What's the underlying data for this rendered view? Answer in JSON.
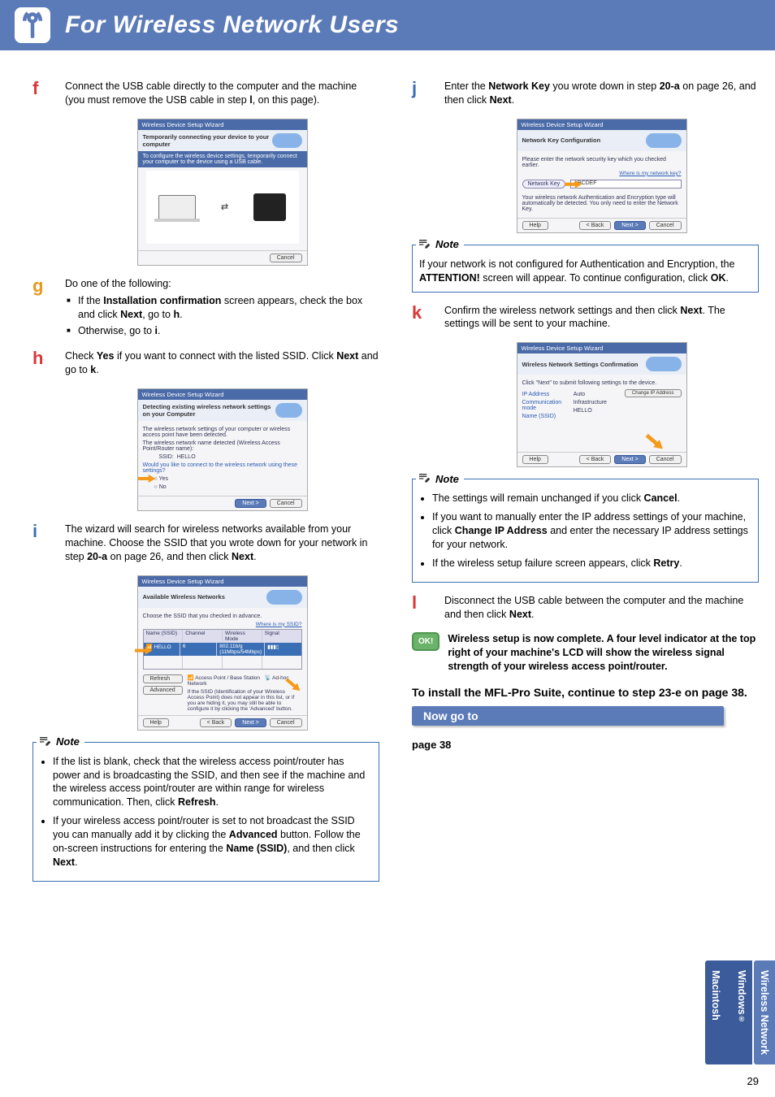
{
  "header": {
    "title": "For Wireless Network Users"
  },
  "left": {
    "f": {
      "letter": "f",
      "text": "Connect the USB cable directly to the computer and the machine (you must remove the USB cable in step ",
      "bold1": "l",
      "text2": ", on this page).",
      "shot_title": "Wireless Device Setup Wizard",
      "shot_sub": "Temporarily connecting your device to your computer",
      "shot_desc": "To configure the wireless device settings, temporarily connect your computer to the device using a USB cable.",
      "btn_cancel": "Cancel"
    },
    "g": {
      "letter": "g",
      "intro": "Do one of the following:",
      "bul1a": "If the ",
      "bul1b": "Installation confirmation",
      "bul1c": " screen appears, check the box and click ",
      "bul1d": "Next",
      "bul1e": ", go to ",
      "bul1f": "h",
      "bul1g": ".",
      "bul2a": "Otherwise, go to ",
      "bul2b": "i",
      "bul2c": "."
    },
    "h": {
      "letter": "h",
      "p1a": "Check ",
      "p1b": "Yes",
      "p1c": " if you want to connect with the listed SSID. Click ",
      "p1d": "Next",
      "p1e": " and go to ",
      "p1f": "k",
      "p1g": ".",
      "shot_title": "Wireless Device Setup Wizard",
      "shot_sub": "Detecting existing wireless network settings on your Computer",
      "shot_l1": "The wireless network settings of your computer or wireless access point have been detected.",
      "shot_l2": "The wireless network name detected (Wireless Access Point/Router name):",
      "shot_ssid_lbl": "SSID:",
      "shot_ssid_val": "HELLO",
      "shot_q": "Would you like to connect to the wireless network using these settings?",
      "yes": "Yes",
      "no": "No",
      "btn_next": "Next >",
      "btn_cancel": "Cancel"
    },
    "i": {
      "letter": "i",
      "p1": "The wizard will search for wireless networks available from your machine. Choose the SSID that you wrote down for your network in step ",
      "p1b": "20-a",
      "p1c": " on page 26, and then click ",
      "p1d": "Next",
      "p1e": ".",
      "shot_title": "Wireless Device Setup Wizard",
      "shot_sub": "Available Wireless Networks",
      "shot_desc": "Choose the SSID that you checked in advance.",
      "where": "Where is my SSID?",
      "th1": "Name (SSID)",
      "th2": "Channel",
      "th3": "Wireless Mode",
      "th4": "Signal",
      "row_name": "HELLO",
      "row_ch": "6",
      "row_mode": "802.11b/g (11Mbps/54Mbps)",
      "refresh": "Refresh",
      "advanced": "Advanced",
      "ap_lbl": "Access Point / Base Station",
      "adhoc": "Ad-hoc Network",
      "adv_desc": "If the SSID (Identification of your Wireless Access Point) does not appear in this list, or if you are hiding it, you may still be able to configure it by clicking the 'Advanced' button.",
      "help": "Help",
      "back": "< Back",
      "next": "Next >",
      "cancel": "Cancel"
    },
    "note": {
      "label": "Note",
      "b1a": "If the list is blank, check that the wireless access point/router has power and is broadcasting the SSID, and then see if the machine and the wireless access point/router are within range for wireless communication. Then, click ",
      "b1b": "Refresh",
      "b1c": ".",
      "b2a": "If your wireless access point/router is set to not broadcast the SSID you can manually add it by clicking the ",
      "b2b": "Advanced",
      "b2c": " button. Follow the on-screen instructions for entering the ",
      "b2d": "Name (SSID)",
      "b2e": ", and then click ",
      "b2f": "Next",
      "b2g": "."
    }
  },
  "right": {
    "j": {
      "letter": "j",
      "p1a": "Enter the ",
      "p1b": "Network Key",
      "p1c": " you wrote down in step ",
      "p1d": "20-a",
      "p1e": " on page 26, and then click ",
      "p1f": "Next",
      "p1g": ".",
      "shot_title": "Wireless Device Setup Wizard",
      "shot_sub": "Network Key Configuration",
      "shot_l1": "Please enter the network security key which you checked earlier.",
      "where": "Where is my network key?",
      "nk_label": "Network Key",
      "nk_val": "ABCDEF",
      "shot_l2": "Your wireless network Authentication and Encryption type will automatically be detected. You only need to enter the Network Key.",
      "help": "Help",
      "back": "< Back",
      "next": "Next >",
      "cancel": "Cancel"
    },
    "note1": {
      "label": "Note",
      "p1a": "If your network is not configured for Authentication and Encryption, the ",
      "p1b": "ATTENTION!",
      "p1c": " screen will appear. To continue configuration, click ",
      "p1d": "OK",
      "p1e": "."
    },
    "k": {
      "letter": "k",
      "p1a": "Confirm the wireless network settings and then click ",
      "p1b": "Next",
      "p1c": ". The settings will be sent to your machine.",
      "shot_title": "Wireless Device Setup Wizard",
      "shot_sub": "Wireless Network Settings Confirmation",
      "shot_l1": "Click \"Next\" to submit following settings to the device.",
      "r1l": "IP Address",
      "r1v": "Auto",
      "r2l": "Communication mode",
      "r2v": "Infrastructure",
      "r3l": "Name (SSID)",
      "r3v": "HELLO",
      "chgip": "Change IP Address",
      "help": "Help",
      "back": "< Back",
      "next": "Next >",
      "cancel": "Cancel"
    },
    "note2": {
      "label": "Note",
      "b1a": "The settings will remain unchanged if you click ",
      "b1b": "Cancel",
      "b1c": ".",
      "b2a": "If you want to manually enter the IP address settings of your machine, click ",
      "b2b": "Change IP Address",
      "b2c": " and enter the necessary IP address settings for your network.",
      "b3a": "If the wireless setup failure screen appears, click ",
      "b3b": "Retry",
      "b3c": "."
    },
    "l": {
      "letter": "l",
      "p1": "Disconnect the USB cable between the computer and the machine and then click ",
      "p1b": "Next",
      "p1c": "."
    },
    "ok": {
      "badge": "OK!",
      "text": "Wireless setup is now complete. A four level indicator at the top right of your machine's LCD will show the wireless signal strength of your wireless access point/router."
    },
    "install": {
      "l1": "To install the MFL-Pro Suite, continue to step ",
      "l2": "23-e",
      "l3": " on page 38."
    },
    "nowgo": "Now go to",
    "pgref": "page 38"
  },
  "tabs": {
    "wireless": "Wireless Network",
    "win": "Windows",
    "reg": "®",
    "mac": "Macintosh"
  },
  "pagenum": "29"
}
